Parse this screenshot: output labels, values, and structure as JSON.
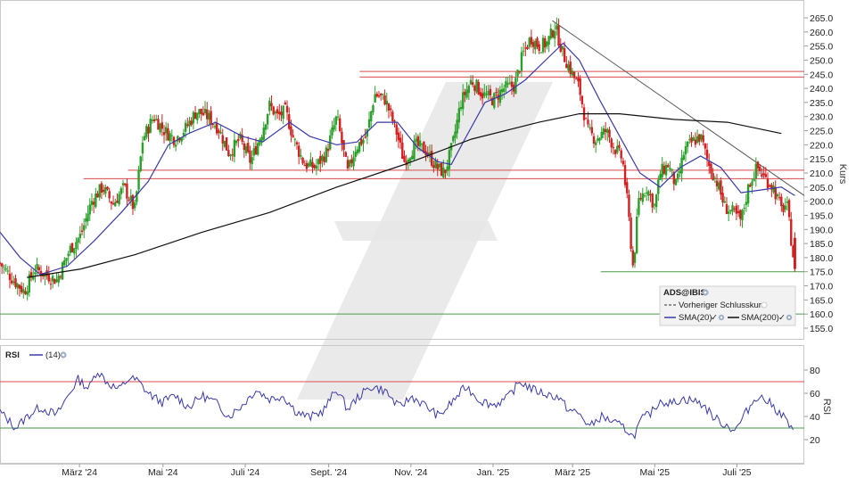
{
  "chart_data": [
    {
      "type": "candlestick",
      "symbol": "ADS@IBIS",
      "ylabel": "Kurs",
      "ylim": [
        150,
        267
      ],
      "y_ticks": [
        155,
        160,
        165,
        170,
        175,
        180,
        185,
        190,
        195,
        200,
        205,
        210,
        215,
        220,
        225,
        230,
        235,
        240,
        245,
        250,
        255,
        260,
        265
      ],
      "x_ticks": [
        {
          "label": "März '24",
          "day": 59
        },
        {
          "label": "Mai '24",
          "day": 121
        },
        {
          "label": "Juli '24",
          "day": 182
        },
        {
          "label": "Sept. '24",
          "day": 244
        },
        {
          "label": "Nov. '24",
          "day": 305
        },
        {
          "label": "Jan. '25",
          "day": 366
        },
        {
          "label": "März '25",
          "day": 425
        },
        {
          "label": "Mai '25",
          "day": 486
        },
        {
          "label": "Juli '25",
          "day": 547
        }
      ],
      "x_range_days": [
        0,
        597
      ],
      "price_path": [
        {
          "day": 0,
          "close": 178
        },
        {
          "day": 10,
          "close": 172
        },
        {
          "day": 18,
          "close": 168
        },
        {
          "day": 26,
          "close": 176
        },
        {
          "day": 34,
          "close": 174
        },
        {
          "day": 42,
          "close": 172
        },
        {
          "day": 52,
          "close": 183
        },
        {
          "day": 60,
          "close": 188
        },
        {
          "day": 68,
          "close": 200
        },
        {
          "day": 76,
          "close": 205
        },
        {
          "day": 84,
          "close": 199
        },
        {
          "day": 92,
          "close": 205
        },
        {
          "day": 100,
          "close": 197
        },
        {
          "day": 106,
          "close": 222
        },
        {
          "day": 114,
          "close": 230
        },
        {
          "day": 122,
          "close": 225
        },
        {
          "day": 130,
          "close": 222
        },
        {
          "day": 138,
          "close": 226
        },
        {
          "day": 146,
          "close": 232
        },
        {
          "day": 154,
          "close": 230
        },
        {
          "day": 162,
          "close": 226
        },
        {
          "day": 170,
          "close": 217
        },
        {
          "day": 178,
          "close": 222
        },
        {
          "day": 186,
          "close": 214
        },
        {
          "day": 194,
          "close": 224
        },
        {
          "day": 200,
          "close": 234
        },
        {
          "day": 206,
          "close": 230
        },
        {
          "day": 212,
          "close": 232
        },
        {
          "day": 218,
          "close": 222
        },
        {
          "day": 226,
          "close": 213
        },
        {
          "day": 234,
          "close": 212
        },
        {
          "day": 242,
          "close": 217
        },
        {
          "day": 250,
          "close": 230
        },
        {
          "day": 258,
          "close": 210
        },
        {
          "day": 264,
          "close": 219
        },
        {
          "day": 272,
          "close": 223
        },
        {
          "day": 278,
          "close": 238
        },
        {
          "day": 286,
          "close": 236
        },
        {
          "day": 294,
          "close": 225
        },
        {
          "day": 300,
          "close": 214
        },
        {
          "day": 308,
          "close": 220
        },
        {
          "day": 316,
          "close": 218
        },
        {
          "day": 324,
          "close": 212
        },
        {
          "day": 330,
          "close": 210
        },
        {
          "day": 336,
          "close": 220
        },
        {
          "day": 342,
          "close": 235
        },
        {
          "day": 350,
          "close": 243
        },
        {
          "day": 358,
          "close": 238
        },
        {
          "day": 366,
          "close": 236
        },
        {
          "day": 374,
          "close": 240
        },
        {
          "day": 382,
          "close": 241
        },
        {
          "day": 388,
          "close": 252
        },
        {
          "day": 394,
          "close": 258
        },
        {
          "day": 400,
          "close": 255
        },
        {
          "day": 406,
          "close": 256
        },
        {
          "day": 412,
          "close": 262
        },
        {
          "day": 418,
          "close": 252
        },
        {
          "day": 424,
          "close": 246
        },
        {
          "day": 430,
          "close": 240
        },
        {
          "day": 436,
          "close": 225
        },
        {
          "day": 442,
          "close": 222
        },
        {
          "day": 450,
          "close": 225
        },
        {
          "day": 456,
          "close": 219
        },
        {
          "day": 462,
          "close": 215
        },
        {
          "day": 466,
          "close": 198
        },
        {
          "day": 470,
          "close": 176
        },
        {
          "day": 474,
          "close": 200
        },
        {
          "day": 480,
          "close": 205
        },
        {
          "day": 486,
          "close": 198
        },
        {
          "day": 490,
          "close": 210
        },
        {
          "day": 496,
          "close": 213
        },
        {
          "day": 502,
          "close": 205
        },
        {
          "day": 508,
          "close": 218
        },
        {
          "day": 514,
          "close": 221
        },
        {
          "day": 520,
          "close": 223
        },
        {
          "day": 526,
          "close": 213
        },
        {
          "day": 532,
          "close": 207
        },
        {
          "day": 538,
          "close": 198
        },
        {
          "day": 544,
          "close": 196
        },
        {
          "day": 550,
          "close": 193
        },
        {
          "day": 556,
          "close": 206
        },
        {
          "day": 562,
          "close": 212
        },
        {
          "day": 568,
          "close": 208
        },
        {
          "day": 574,
          "close": 205
        },
        {
          "day": 580,
          "close": 197
        },
        {
          "day": 584,
          "close": 199
        },
        {
          "day": 590,
          "close": 176
        }
      ],
      "series": [
        {
          "name": "SMA(20)",
          "color": "#3a3aa8",
          "points": [
            {
              "day": 0,
              "value": 189
            },
            {
              "day": 15,
              "value": 180
            },
            {
              "day": 30,
              "value": 174
            },
            {
              "day": 50,
              "value": 177
            },
            {
              "day": 70,
              "value": 186
            },
            {
              "day": 90,
              "value": 196
            },
            {
              "day": 110,
              "value": 207
            },
            {
              "day": 125,
              "value": 220
            },
            {
              "day": 140,
              "value": 224
            },
            {
              "day": 160,
              "value": 228
            },
            {
              "day": 180,
              "value": 223
            },
            {
              "day": 195,
              "value": 221
            },
            {
              "day": 215,
              "value": 228
            },
            {
              "day": 230,
              "value": 223
            },
            {
              "day": 250,
              "value": 220
            },
            {
              "day": 265,
              "value": 221
            },
            {
              "day": 280,
              "value": 228
            },
            {
              "day": 295,
              "value": 228
            },
            {
              "day": 310,
              "value": 219
            },
            {
              "day": 325,
              "value": 214
            },
            {
              "day": 335,
              "value": 213
            },
            {
              "day": 345,
              "value": 222
            },
            {
              "day": 360,
              "value": 235
            },
            {
              "day": 375,
              "value": 238
            },
            {
              "day": 390,
              "value": 243
            },
            {
              "day": 405,
              "value": 250
            },
            {
              "day": 418,
              "value": 256
            },
            {
              "day": 430,
              "value": 250
            },
            {
              "day": 445,
              "value": 236
            },
            {
              "day": 460,
              "value": 223
            },
            {
              "day": 475,
              "value": 210
            },
            {
              "day": 490,
              "value": 205
            },
            {
              "day": 505,
              "value": 212
            },
            {
              "day": 520,
              "value": 216
            },
            {
              "day": 535,
              "value": 212
            },
            {
              "day": 550,
              "value": 203
            },
            {
              "day": 565,
              "value": 204
            },
            {
              "day": 580,
              "value": 205
            },
            {
              "day": 590,
              "value": 202
            }
          ]
        },
        {
          "name": "SMA(200)",
          "color": "#111111",
          "points": [
            {
              "day": 20,
              "value": 173
            },
            {
              "day": 60,
              "value": 176
            },
            {
              "day": 100,
              "value": 181
            },
            {
              "day": 150,
              "value": 189
            },
            {
              "day": 200,
              "value": 196
            },
            {
              "day": 250,
              "value": 205
            },
            {
              "day": 300,
              "value": 213
            },
            {
              "day": 350,
              "value": 222
            },
            {
              "day": 400,
              "value": 228
            },
            {
              "day": 430,
              "value": 231
            },
            {
              "day": 460,
              "value": 231
            },
            {
              "day": 500,
              "value": 229
            },
            {
              "day": 540,
              "value": 228
            },
            {
              "day": 580,
              "value": 224
            }
          ]
        },
        {
          "name": "Vorheriger Schlusskurs",
          "color": "#777777",
          "style": "dashed",
          "points": []
        }
      ],
      "horizontal_lines": [
        {
          "value": 246,
          "from_day": 267,
          "to_day": 597,
          "color": "#d94a4a"
        },
        {
          "value": 244,
          "from_day": 267,
          "to_day": 597,
          "color": "#d94a4a"
        },
        {
          "value": 211,
          "from_day": 95,
          "to_day": 597,
          "color": "#d94a4a"
        },
        {
          "value": 208,
          "from_day": 62,
          "to_day": 597,
          "color": "#d94a4a"
        },
        {
          "value": 175,
          "from_day": 446,
          "to_day": 597,
          "color": "#4a9a4a"
        },
        {
          "value": 160,
          "from_day": 0,
          "to_day": 597,
          "color": "#4a9a4a"
        }
      ],
      "trendline": {
        "from": {
          "day": 410,
          "value": 264
        },
        "to": {
          "day": 597,
          "value": 202
        },
        "color": "#555555"
      },
      "legend": {
        "placement": "bottom-right",
        "title": "ADS@IBIS",
        "entries": [
          "Vorheriger Schlusskurs",
          "SMA(20)",
          "SMA(200)"
        ]
      }
    },
    {
      "type": "line",
      "name": "RSI",
      "indicator_label": "RSI",
      "parameter_label": "(14)",
      "ylabel": "RSI",
      "ylim": [
        10,
        88
      ],
      "y_ticks": [
        20,
        40,
        60,
        80
      ],
      "levels": [
        {
          "value": 70,
          "color": "#d94a4a"
        },
        {
          "value": 30,
          "color": "#4a9a4a"
        }
      ],
      "color": "#3a3aa8",
      "points": [
        {
          "day": 0,
          "value": 44
        },
        {
          "day": 12,
          "value": 30
        },
        {
          "day": 20,
          "value": 40
        },
        {
          "day": 30,
          "value": 48
        },
        {
          "day": 42,
          "value": 41
        },
        {
          "day": 50,
          "value": 57
        },
        {
          "day": 58,
          "value": 72
        },
        {
          "day": 66,
          "value": 64
        },
        {
          "day": 72,
          "value": 80
        },
        {
          "day": 80,
          "value": 69
        },
        {
          "day": 88,
          "value": 63
        },
        {
          "day": 96,
          "value": 73
        },
        {
          "day": 102,
          "value": 71
        },
        {
          "day": 110,
          "value": 60
        },
        {
          "day": 120,
          "value": 52
        },
        {
          "day": 130,
          "value": 58
        },
        {
          "day": 140,
          "value": 48
        },
        {
          "day": 150,
          "value": 58
        },
        {
          "day": 160,
          "value": 52
        },
        {
          "day": 170,
          "value": 40
        },
        {
          "day": 180,
          "value": 50
        },
        {
          "day": 190,
          "value": 63
        },
        {
          "day": 200,
          "value": 55
        },
        {
          "day": 210,
          "value": 58
        },
        {
          "day": 220,
          "value": 44
        },
        {
          "day": 230,
          "value": 39
        },
        {
          "day": 240,
          "value": 45
        },
        {
          "day": 250,
          "value": 64
        },
        {
          "day": 258,
          "value": 46
        },
        {
          "day": 266,
          "value": 57
        },
        {
          "day": 276,
          "value": 66
        },
        {
          "day": 286,
          "value": 62
        },
        {
          "day": 296,
          "value": 48
        },
        {
          "day": 306,
          "value": 57
        },
        {
          "day": 316,
          "value": 49
        },
        {
          "day": 326,
          "value": 40
        },
        {
          "day": 336,
          "value": 53
        },
        {
          "day": 346,
          "value": 66
        },
        {
          "day": 356,
          "value": 54
        },
        {
          "day": 366,
          "value": 50
        },
        {
          "day": 376,
          "value": 55
        },
        {
          "day": 386,
          "value": 70
        },
        {
          "day": 396,
          "value": 63
        },
        {
          "day": 406,
          "value": 59
        },
        {
          "day": 414,
          "value": 57
        },
        {
          "day": 422,
          "value": 46
        },
        {
          "day": 430,
          "value": 42
        },
        {
          "day": 438,
          "value": 31
        },
        {
          "day": 446,
          "value": 40
        },
        {
          "day": 454,
          "value": 36
        },
        {
          "day": 460,
          "value": 32
        },
        {
          "day": 466,
          "value": 28
        },
        {
          "day": 470,
          "value": 22
        },
        {
          "day": 476,
          "value": 37
        },
        {
          "day": 484,
          "value": 44
        },
        {
          "day": 490,
          "value": 54
        },
        {
          "day": 498,
          "value": 51
        },
        {
          "day": 506,
          "value": 55
        },
        {
          "day": 514,
          "value": 54
        },
        {
          "day": 522,
          "value": 50
        },
        {
          "day": 530,
          "value": 39
        },
        {
          "day": 538,
          "value": 33
        },
        {
          "day": 546,
          "value": 28
        },
        {
          "day": 554,
          "value": 44
        },
        {
          "day": 562,
          "value": 58
        },
        {
          "day": 570,
          "value": 53
        },
        {
          "day": 578,
          "value": 44
        },
        {
          "day": 584,
          "value": 37
        },
        {
          "day": 590,
          "value": 22
        }
      ]
    }
  ]
}
